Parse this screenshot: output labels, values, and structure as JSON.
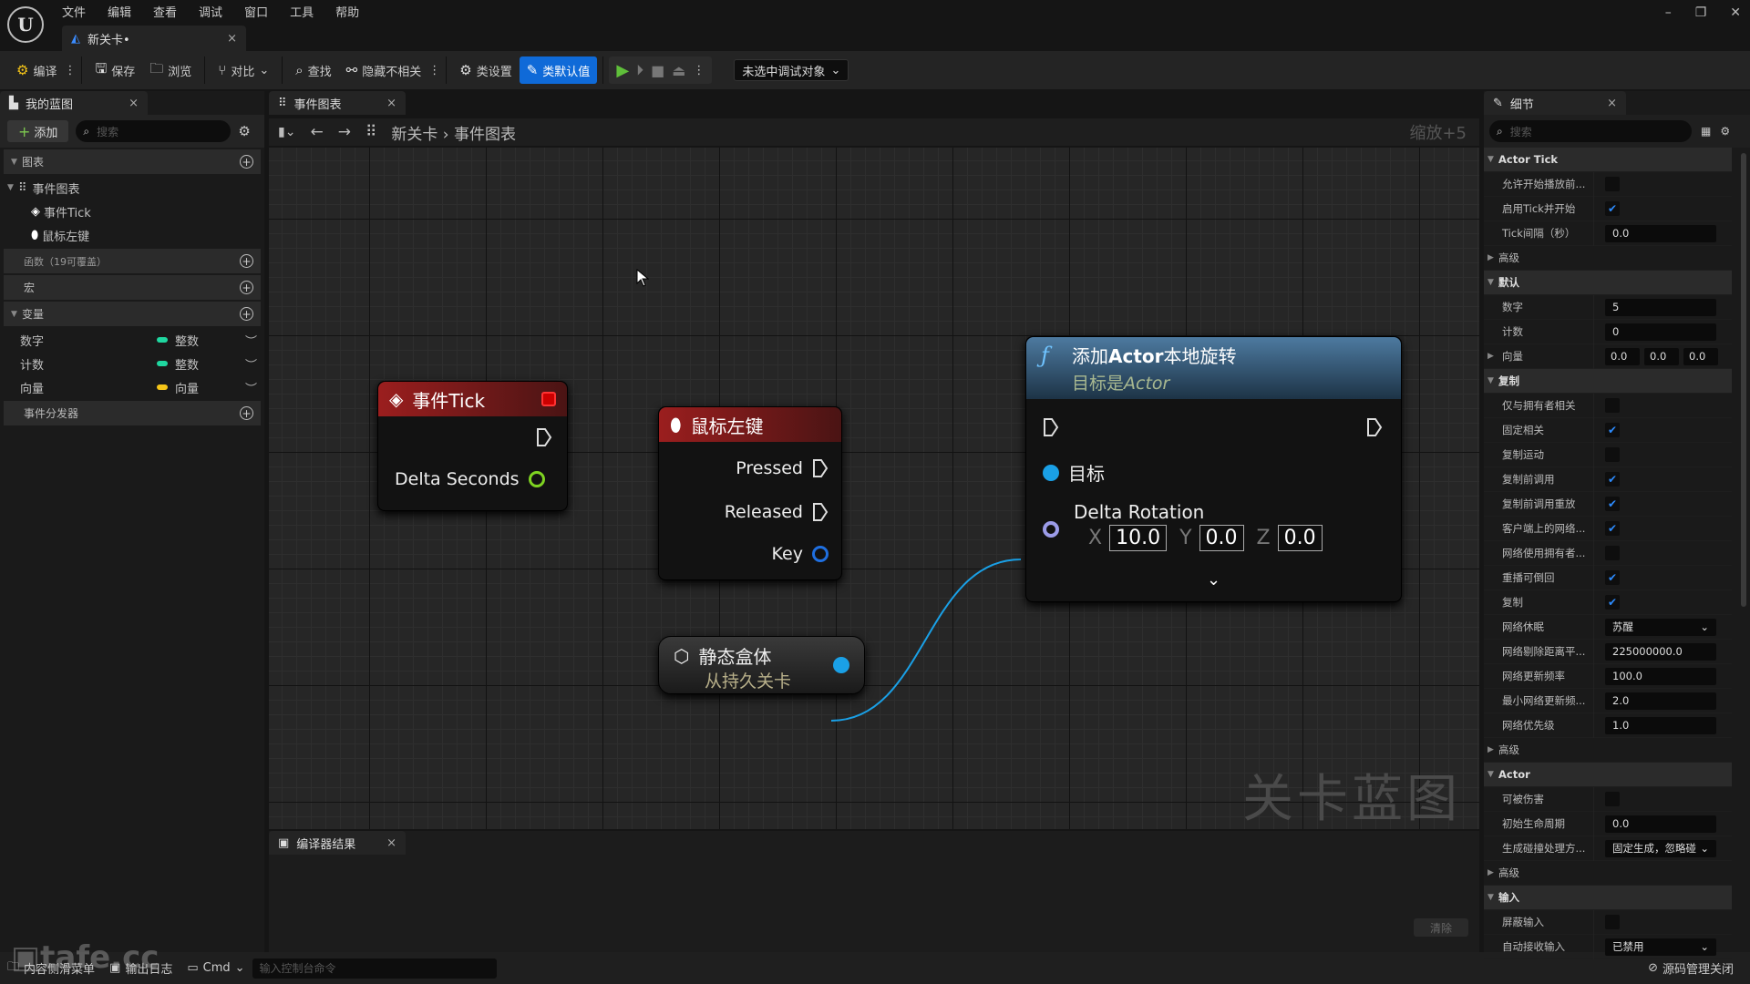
{
  "app": {
    "menu": [
      "文件",
      "编辑",
      "查看",
      "调试",
      "窗口",
      "工具",
      "帮助"
    ],
    "doc_tab": "新关卡•",
    "logo": "U"
  },
  "toolbar": {
    "compile": "编译",
    "save": "保存",
    "browse": "浏览",
    "diff": "对比",
    "find": "查找",
    "hide_unrelated": "隐藏不相关",
    "class_settings": "类设置",
    "class_defaults": "类默认值",
    "debug_target": "未选中调试对象"
  },
  "left": {
    "tab": "我的蓝图",
    "add": "添加",
    "search_placeholder": "搜索",
    "graphs_header": "图表",
    "event_graph": "事件图表",
    "event_items": [
      "事件Tick",
      "鼠标左键"
    ],
    "functions_header": "函数（19可覆盖）",
    "macros_header": "宏",
    "variables_header": "变量",
    "variables": [
      {
        "name": "数字",
        "type": "整数",
        "color": "#1fd7a0"
      },
      {
        "name": "计数",
        "type": "整数",
        "color": "#1fd7a0"
      },
      {
        "name": "向量",
        "type": "向量",
        "color": "#f5c518"
      }
    ],
    "dispatchers_header": "事件分发器"
  },
  "graph": {
    "tab": "事件图表",
    "breadcrumb": [
      "新关卡",
      "事件图表"
    ],
    "zoom": "缩放+5",
    "watermark": "关卡蓝图",
    "nodes": {
      "tick": {
        "title": "事件Tick",
        "pin": "Delta Seconds",
        "color": "#8a1a1a"
      },
      "mouse": {
        "title": "鼠标左键",
        "pins": [
          "Pressed",
          "Released",
          "Key"
        ],
        "color": "#8a1a1a"
      },
      "static": {
        "title": "静态盒体",
        "subtitle": "从持久关卡"
      },
      "rotate": {
        "title_pre": "添加",
        "title_bold": "Actor",
        "title_post": "本地旋转",
        "subtitle_pre": "目标是",
        "subtitle_em": "Actor",
        "target": "目标",
        "delta": "Delta Rotation",
        "x": "10.0",
        "y": "0.0",
        "z": "0.0",
        "axis_x": "X",
        "axis_y": "Y",
        "axis_z": "Z"
      }
    }
  },
  "bottom": {
    "tab": "编译器结果",
    "clear": "清除"
  },
  "status": {
    "content_drawer": "内容侧滑菜单",
    "output_log": "输出日志",
    "cmd": "Cmd",
    "console_placeholder": "输入控制台命令",
    "source_control": "源码管理关闭",
    "watermark": "tafe.cc"
  },
  "details": {
    "tab": "细节",
    "search_placeholder": "搜索",
    "rows": [
      {
        "k": "section",
        "label": "Actor Tick"
      },
      {
        "k": "check",
        "label": "允许开始播放前...",
        "value": false
      },
      {
        "k": "check",
        "label": "启用Tick并开始",
        "value": true
      },
      {
        "k": "text",
        "label": "Tick间隔（秒）",
        "value": "0.0"
      },
      {
        "k": "sub",
        "label": "高级"
      },
      {
        "k": "section",
        "label": "默认"
      },
      {
        "k": "text",
        "label": "数字",
        "value": "5"
      },
      {
        "k": "text",
        "label": "计数",
        "value": "0"
      },
      {
        "k": "vec",
        "label": "向量",
        "value": [
          "0.0",
          "0.0",
          "0.0"
        ]
      },
      {
        "k": "section",
        "label": "复制"
      },
      {
        "k": "check",
        "label": "仅与拥有者相关",
        "value": false
      },
      {
        "k": "check",
        "label": "固定相关",
        "value": true
      },
      {
        "k": "check",
        "label": "复制运动",
        "value": false
      },
      {
        "k": "check",
        "label": "复制前调用",
        "value": true
      },
      {
        "k": "check",
        "label": "复制前调用重放",
        "value": true
      },
      {
        "k": "check",
        "label": "客户端上的网络...",
        "value": true
      },
      {
        "k": "check",
        "label": "网络使用拥有者...",
        "value": false
      },
      {
        "k": "check",
        "label": "重播可倒回",
        "value": true
      },
      {
        "k": "check",
        "label": "复制",
        "value": true
      },
      {
        "k": "drop",
        "label": "网络休眠",
        "value": "苏醒"
      },
      {
        "k": "text",
        "label": "网络剔除距离平...",
        "value": "225000000.0"
      },
      {
        "k": "text",
        "label": "网络更新频率",
        "value": "100.0"
      },
      {
        "k": "text",
        "label": "最小网络更新频...",
        "value": "2.0"
      },
      {
        "k": "text",
        "label": "网络优先级",
        "value": "1.0"
      },
      {
        "k": "sub",
        "label": "高级"
      },
      {
        "k": "section",
        "label": "Actor"
      },
      {
        "k": "check",
        "label": "可被伤害",
        "value": false
      },
      {
        "k": "text",
        "label": "初始生命周期",
        "value": "0.0"
      },
      {
        "k": "drop",
        "label": "生成碰撞处理方...",
        "value": "固定生成，忽略碰"
      },
      {
        "k": "sub",
        "label": "高级"
      },
      {
        "k": "section",
        "label": "输入"
      },
      {
        "k": "check",
        "label": "屏蔽输入",
        "value": false
      },
      {
        "k": "drop",
        "label": "自动接收输入",
        "value": "已禁用"
      }
    ]
  }
}
